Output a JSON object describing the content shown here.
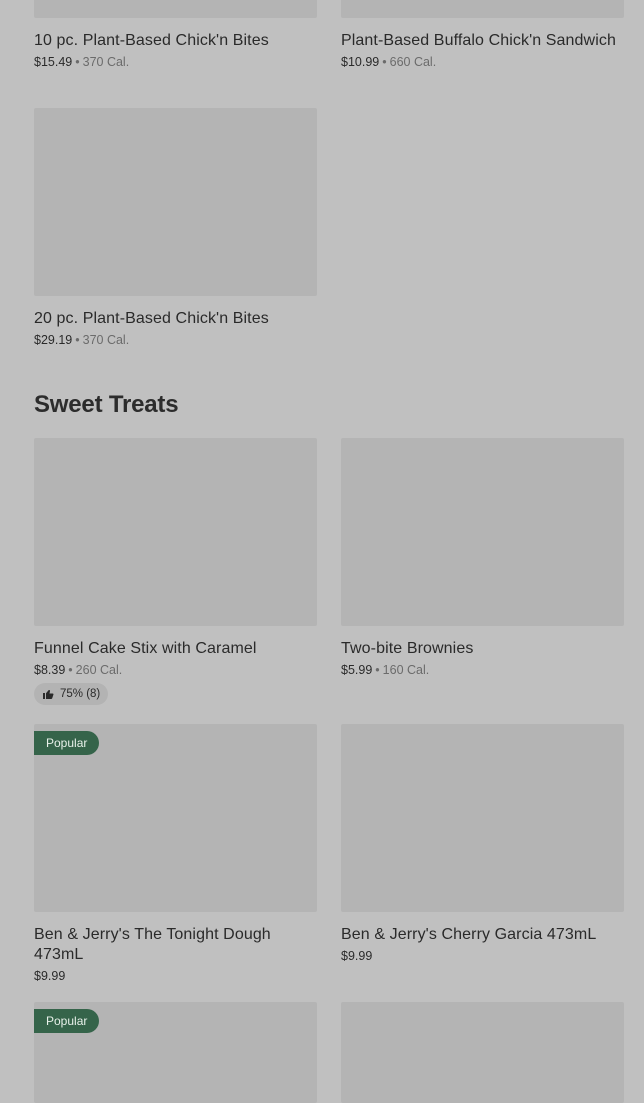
{
  "sections": {
    "sweet_treats_title": "Sweet Treats"
  },
  "items": {
    "bites10": {
      "name": "10 pc. Plant-Based Chick'n Bites",
      "price": "$15.49",
      "calories": "370 Cal."
    },
    "buffalo": {
      "name": "Plant-Based Buffalo Chick'n Sandwich",
      "price": "$10.99",
      "calories": "660 Cal."
    },
    "bites20": {
      "name": "20 pc. Plant-Based Chick'n Bites",
      "price": "$29.19",
      "calories": "370 Cal."
    },
    "funnel": {
      "name": "Funnel Cake Stix with Caramel",
      "price": "$8.39",
      "calories": "260 Cal.",
      "rating": "75% (8)"
    },
    "brownies": {
      "name": "Two-bite Brownies",
      "price": "$5.99",
      "calories": "160 Cal."
    },
    "tonight_dough": {
      "name": "Ben & Jerry's The Tonight Dough 473mL",
      "price": "$9.99",
      "badge": "Popular"
    },
    "cherry_garcia": {
      "name": "Ben & Jerry's Cherry Garcia 473mL",
      "price": "$9.99"
    },
    "next_left": {
      "badge": "Popular"
    }
  },
  "separator": "•",
  "icons": {
    "rating": "thumbs-up-icon"
  },
  "colors": {
    "background": "#c0c0c0",
    "image_placeholder": "#b4b4b4",
    "popular_badge": "#35644a"
  }
}
